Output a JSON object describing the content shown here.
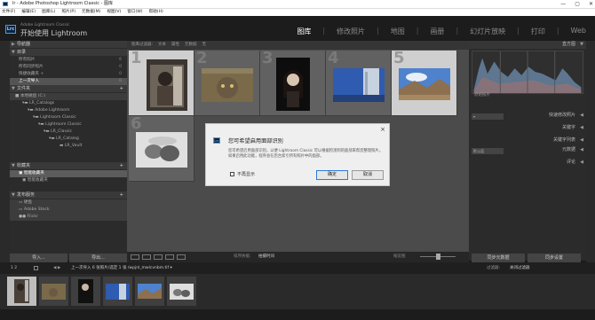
{
  "window": {
    "title": "lr - Adobe Photoshop Lightroom Classic - 图库",
    "controls": [
      "—",
      "▢",
      "✕"
    ]
  },
  "menu": [
    "文件(F)",
    "编辑(E)",
    "图库(L)",
    "照片(P)",
    "元数据(M)",
    "视图(V)",
    "窗口(W)",
    "帮助(H)"
  ],
  "identity": {
    "logo": "Lrc",
    "line1": "Adobe Lightroom Classic",
    "line2": "开始使用 Lightroom"
  },
  "modules": [
    "图库",
    "修改照片",
    "地图",
    "画册",
    "幻灯片放映",
    "打印",
    "Web"
  ],
  "left": {
    "navigator": "导航器",
    "catalog": {
      "title": "目录",
      "items": [
        {
          "label": "所有照片",
          "count": "6"
        },
        {
          "label": "所有同步照片",
          "count": "0"
        },
        {
          "label": "快捷收藏夹 +",
          "count": "0"
        },
        {
          "label": "上一次导入",
          "count": "6"
        }
      ]
    },
    "folders": {
      "title": "文件夹",
      "volume": "本地磁盘 (C:)",
      "items": [
        "LR_Catalogs",
        "Adobe Lightroom",
        "Lightroom Classic",
        "Lightroom Classic",
        "LR_Classic",
        "LR_Catalog",
        "LR_Vault"
      ]
    },
    "collections": {
      "title": "收藏夹",
      "items": [
        "智能收藏夹",
        "智能收藏夹"
      ]
    },
    "publish": {
      "title": "发布服务",
      "items": [
        "硬盘",
        "Adobe Stock",
        "Flickr",
        "查找更多服务..."
      ]
    },
    "import_label": "导入...",
    "export_label": "导出..."
  },
  "filter": [
    "图库过滤器:",
    "文本",
    "属性",
    "元数据",
    "无"
  ],
  "grid": {
    "numbers": [
      "1",
      "2",
      "3",
      "4",
      "5",
      "6"
    ]
  },
  "dialog": {
    "logo": "Lrc",
    "title": "您可希望启用面部识别",
    "text": "您可希望启用面部识别，以便 Lightroom Classic 可以根据检测到的面部来帮您整理照片。如果启用此功能，程序会在后台索引所有照片中的面部。",
    "checkbox": "不再显示",
    "ok": "确定",
    "cancel": "取消",
    "close": "×"
  },
  "toolbar": {
    "sort_label": "排序依据:",
    "sort_value": "拍摄时间",
    "thumb_label": "缩览图"
  },
  "right": {
    "histogram": "直方图",
    "original": "原始照片",
    "quick_develop": "快速修改照片",
    "keywording": "关键字",
    "keyword_list": "关键字列表",
    "metadata": "元数据",
    "default": "默认值",
    "comments": "评论",
    "sync_meta": "同步元数据",
    "sync_settings": "同步设置"
  },
  "filmstrip": {
    "breadcrumb": "上一次导入 6 张照片/选定 1 张 /wpjnl_mwlcvnbm.tif ▾",
    "filter_label": "过滤器:",
    "filter_value": "关闭过滤器",
    "page": "1 2"
  }
}
